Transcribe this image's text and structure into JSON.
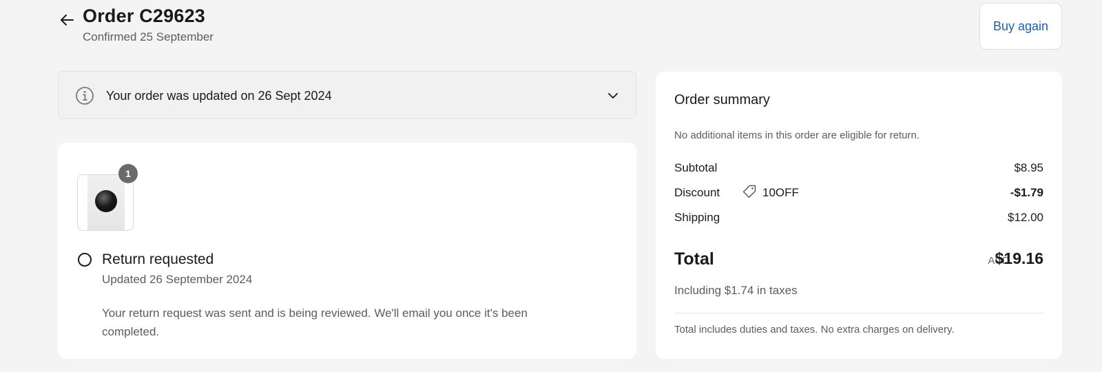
{
  "header": {
    "title": "Order C29623",
    "subtitle": "Confirmed 25 September",
    "buy_again_label": "Buy again"
  },
  "banner": {
    "text": "Your order was updated on 26 Sept 2024"
  },
  "return_item": {
    "quantity": "1",
    "status_title": "Return requested",
    "status_date": "Updated 26 September 2024",
    "message": "Your return request was sent and is being reviewed. We'll email you once it's been completed."
  },
  "summary": {
    "heading": "Order summary",
    "note": "No additional items in this order are eligible for return.",
    "subtotal_label": "Subtotal",
    "subtotal_value": "$8.95",
    "discount_label": "Discount",
    "discount_code": "10OFF",
    "discount_value": "-$1.79",
    "shipping_label": "Shipping",
    "shipping_value": "$12.00",
    "total_label": "Total",
    "total_currency": "AUD",
    "total_value": "$19.16",
    "taxes_note": "Including $1.74 in taxes",
    "duties_note": "Total includes duties and taxes. No extra charges on delivery."
  },
  "colors": {
    "background": "#f4f4f4",
    "card": "#ffffff",
    "link": "#1f5fa8",
    "muted_text": "#5c5c5c"
  },
  "icons": [
    "arrow-left-icon",
    "info-icon",
    "chevron-down-icon",
    "tag-icon"
  ]
}
